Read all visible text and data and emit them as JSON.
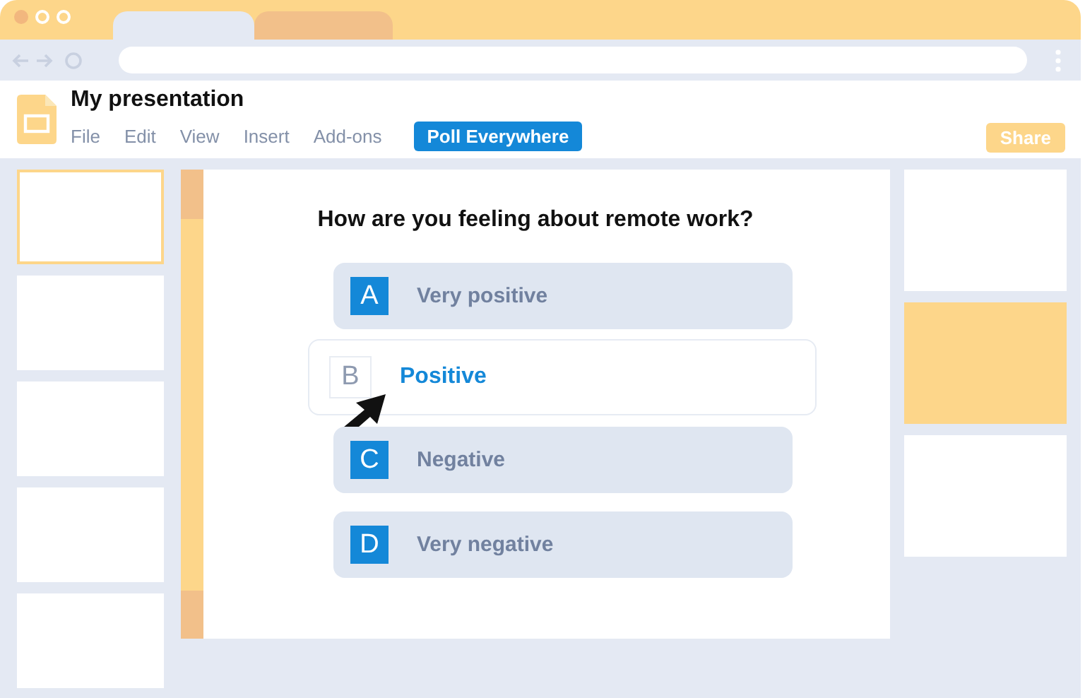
{
  "app": {
    "title": "My presentation"
  },
  "menu": [
    {
      "label": "File",
      "selected": false
    },
    {
      "label": "Edit",
      "selected": false
    },
    {
      "label": "View",
      "selected": false
    },
    {
      "label": "Insert",
      "selected": false
    },
    {
      "label": "Add-ons",
      "selected": false
    },
    {
      "label": "Poll Everywhere",
      "selected": true
    }
  ],
  "share_button": "Share",
  "slides": [
    {
      "selected": true
    },
    {
      "selected": false
    },
    {
      "selected": false
    },
    {
      "selected": false
    },
    {
      "selected": false
    }
  ],
  "poll": {
    "question": "How are you feeling about remote work?",
    "options": [
      {
        "letter": "A",
        "label": "Very positive",
        "selected": false
      },
      {
        "letter": "B",
        "label": "Positive",
        "selected": true
      },
      {
        "letter": "C",
        "label": "Negative",
        "selected": false
      },
      {
        "letter": "D",
        "label": "Very negative",
        "selected": false
      }
    ]
  }
}
